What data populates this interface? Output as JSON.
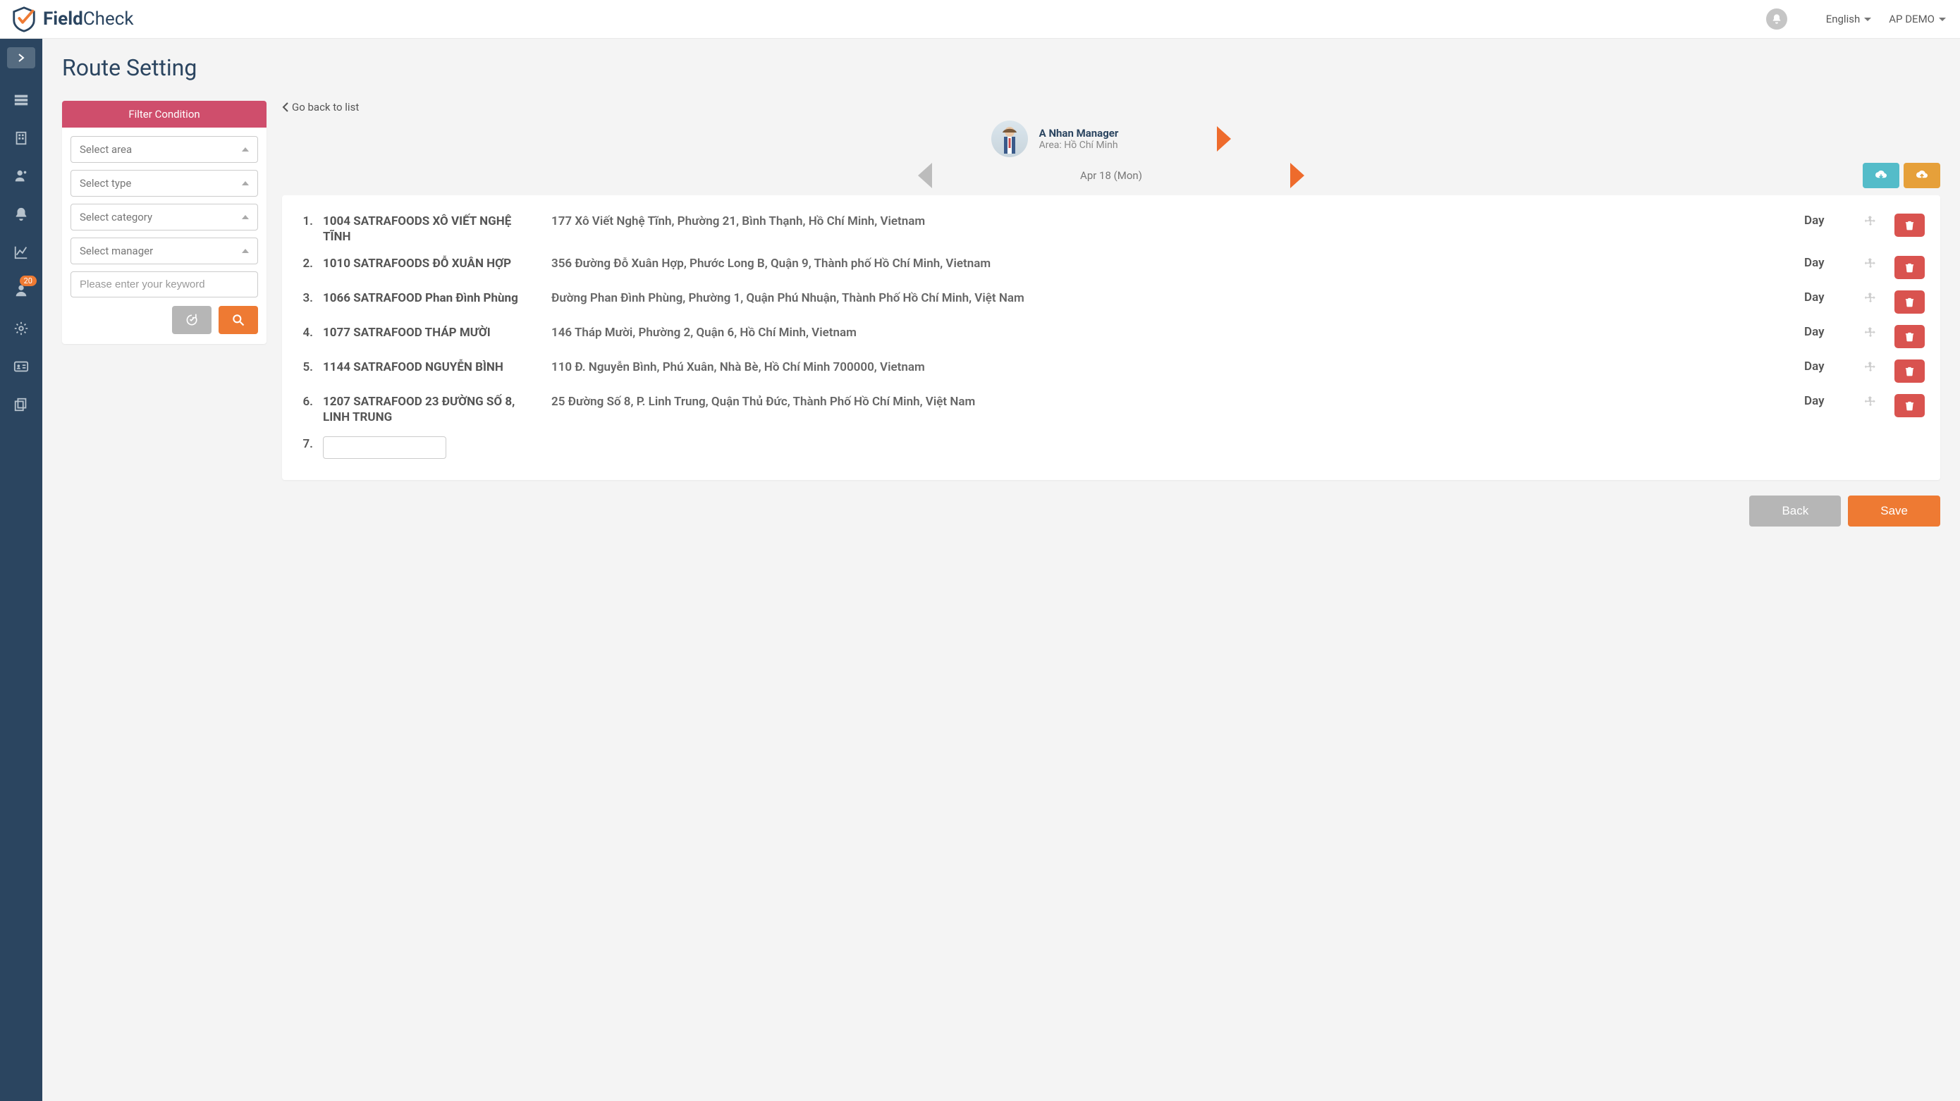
{
  "brand": {
    "first": "Field",
    "second": "Check"
  },
  "header": {
    "language": "English",
    "user": "AP DEMO"
  },
  "sidebar": {
    "badge": "20"
  },
  "page": {
    "title": "Route Setting"
  },
  "filter": {
    "header": "Filter Condition",
    "area": "Select area",
    "type": "Select type",
    "category": "Select category",
    "manager": "Select manager",
    "keyword_placeholder": "Please enter your keyword"
  },
  "route": {
    "back": "Go back to list",
    "person_name": "A Nhan Manager",
    "person_area": "Area: Hồ Chí Minh",
    "date": "Apr 18 (Mon)",
    "items": [
      {
        "num": "1.",
        "name": "1004 SATRAFOODS XÔ VIẾT NGHỆ TĨNH",
        "addr": "177 Xô Viết Nghệ Tĩnh, Phường 21, Bình Thạnh, Hồ Chí Minh, Vietnam",
        "period": "Day"
      },
      {
        "num": "2.",
        "name": "1010 SATRAFOODS ĐỖ XUÂN HỢP",
        "addr": "356 Đường Đỗ Xuân Hợp, Phước Long B, Quận 9, Thành phố Hồ Chí Minh, Vietnam",
        "period": "Day"
      },
      {
        "num": "3.",
        "name": "1066 SATRAFOOD Phan Đình Phùng",
        "addr": "Đường Phan Đình Phùng, Phường 1, Quận Phú Nhuận, Thành Phố Hồ Chí Minh, Việt Nam",
        "period": "Day"
      },
      {
        "num": "4.",
        "name": "1077 SATRAFOOD THÁP MƯỜI",
        "addr": "146 Tháp Mười, Phường 2, Quận 6, Hồ Chí Minh, Vietnam",
        "period": "Day"
      },
      {
        "num": "5.",
        "name": "1144 SATRAFOOD NGUYỄN BÌNH",
        "addr": "110 Đ. Nguyễn Bình, Phú Xuân, Nhà Bè, Hồ Chí Minh 700000, Vietnam",
        "period": "Day"
      },
      {
        "num": "6.",
        "name": "1207 SATRAFOOD 23 ĐƯỜNG SỐ 8, LINH TRUNG",
        "addr": "25 Đường Số 8, P. Linh Trung, Quận Thủ Đức, Thành Phố Hồ Chí Minh, Việt Nam",
        "period": "Day"
      }
    ],
    "empty_num": "7."
  },
  "footer": {
    "back": "Back",
    "save": "Save"
  }
}
